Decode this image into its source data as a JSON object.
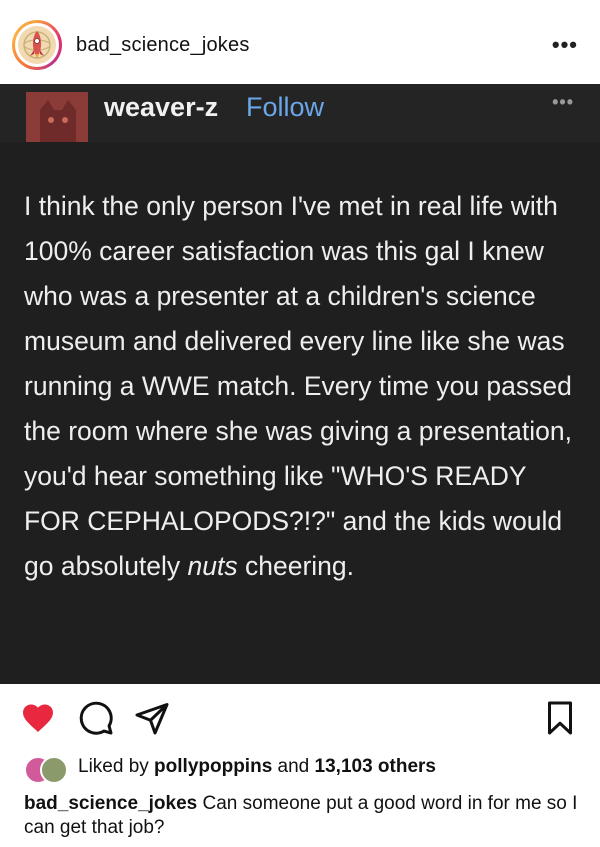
{
  "header": {
    "username": "bad_science_jokes",
    "more_icon": "more-horizontal-icon",
    "more_glyph": "•••"
  },
  "post": {
    "author": "weaver-z",
    "follow_label": "Follow",
    "more_glyph": "•••",
    "body_before": "I think the only person I've met in real life with 100% career satisfaction was this gal I knew who was a presenter at a children's science museum and delivered every line like she was running a WWE match. Every time you passed the room where she was giving a presentation, you'd hear something like \"WHO'S READY FOR CEPHALOPODS?!?\" and the kids would go absolutely ",
    "body_emphasis": "nuts",
    "body_after": " cheering."
  },
  "actions": {
    "like_icon": "heart-icon",
    "comment_icon": "comment-icon",
    "share_icon": "share-icon",
    "save_icon": "bookmark-icon",
    "like_color": "#e7283e"
  },
  "likes": {
    "prefix": "Liked by ",
    "user": "pollypoppins",
    "middle": " and ",
    "count": "13,103 others"
  },
  "caption": {
    "user": "bad_science_jokes",
    "text": " Can someone put a good word in for me so I can get that job?"
  }
}
